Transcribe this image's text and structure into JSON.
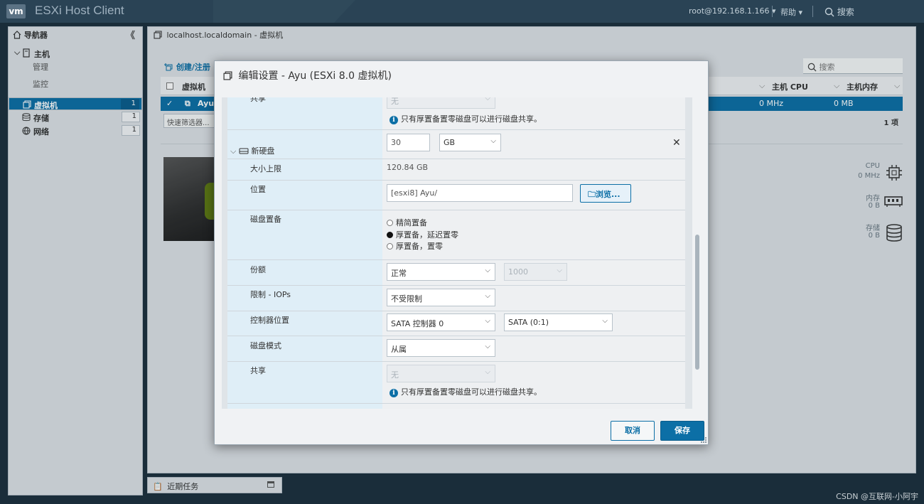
{
  "topbar": {
    "logo": "vm",
    "app_title": "ESXi Host Client",
    "user": "root@192.168.1.166 ▾",
    "help": "帮助 ▾",
    "search": "搜索"
  },
  "navigator": {
    "title": "导航器",
    "collapse": "《",
    "items": [
      {
        "label": "主机",
        "count": ""
      },
      {
        "label": "管理",
        "count": ""
      },
      {
        "label": "监控",
        "count": ""
      },
      {
        "label": "虚拟机",
        "count": "1"
      },
      {
        "label": "存储",
        "count": "1"
      },
      {
        "label": "网络",
        "count": "1"
      }
    ]
  },
  "content": {
    "breadcrumb": "localhost.localdomain - 虚拟机",
    "create_label": "创建/注册",
    "search_placeholder": "搜索",
    "columns": {
      "vm": "虚拟机",
      "host_cpu": "主机 CPU",
      "host_mem": "主机内存"
    },
    "row": {
      "name": "Ayu",
      "cpu": "0 MHz",
      "mem": "0 MB"
    },
    "quick_filter": "快速筛选器...",
    "item_count": "1 项",
    "stats": [
      {
        "label": "CPU",
        "value": "0 MHz"
      },
      {
        "label": "内存",
        "value": "0 B"
      },
      {
        "label": "存储",
        "value": "0 B"
      }
    ]
  },
  "recent_tasks": "近期任务",
  "watermark": "CSDN @互联网-小阿宇",
  "modal": {
    "title": "编辑设置 - Ayu (ESXi 8.0 虚拟机)",
    "top_partial": {
      "label": "共享",
      "select": "无",
      "info": "只有厚置备置零磁盘可以进行磁盘共享。"
    },
    "disk": {
      "label": "新硬盘",
      "size_value": "30",
      "size_unit": "GB",
      "max_size_label": "大小上限",
      "max_size_value": "120.84 GB",
      "location_label": "位置",
      "location_value": "[esxi8] Ayu/",
      "browse_label": "浏览...",
      "provision_label": "磁盘置备",
      "provision_options": [
        "精简置备",
        "厚置备，延迟置零",
        "厚置备，置零"
      ],
      "shares_label": "份额",
      "shares_value": "正常",
      "shares_number": "1000",
      "limit_label": "限制 - IOPs",
      "limit_value": "不受限制",
      "controller_label": "控制器位置",
      "controller_value": "SATA 控制器 0",
      "controller_slot": "SATA (0:1)",
      "mode_label": "磁盘模式",
      "mode_value": "从属",
      "sharing_label": "共享",
      "sharing_value": "无",
      "sharing_info": "只有厚置备置零磁盘可以进行磁盘共享。"
    },
    "cancel_label": "取消",
    "save_label": "保存"
  }
}
